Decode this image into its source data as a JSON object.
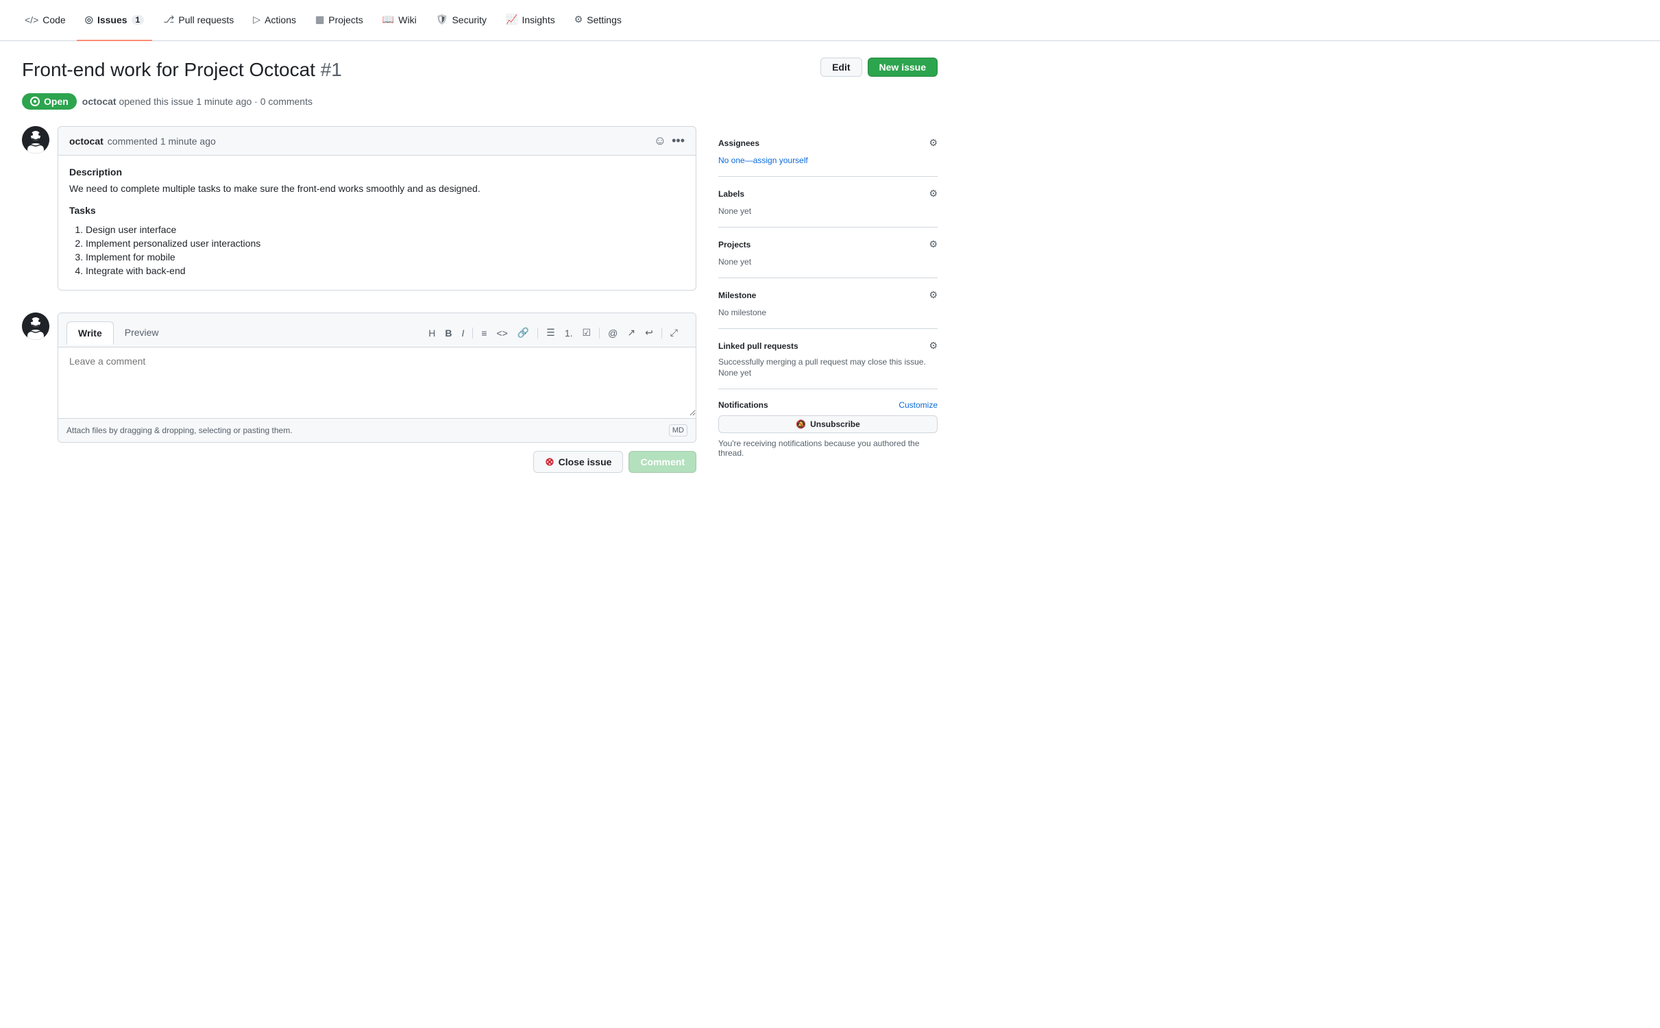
{
  "nav": {
    "items": [
      {
        "id": "code",
        "icon": "<>",
        "label": "Code",
        "badge": null,
        "active": false
      },
      {
        "id": "issues",
        "icon": "◎",
        "label": "Issues",
        "badge": "1",
        "active": true
      },
      {
        "id": "pull-requests",
        "icon": "⎇",
        "label": "Pull requests",
        "badge": null,
        "active": false
      },
      {
        "id": "actions",
        "icon": "▷",
        "label": "Actions",
        "badge": null,
        "active": false
      },
      {
        "id": "projects",
        "icon": "▦",
        "label": "Projects",
        "badge": null,
        "active": false
      },
      {
        "id": "wiki",
        "icon": "📖",
        "label": "Wiki",
        "badge": null,
        "active": false
      },
      {
        "id": "security",
        "icon": "🛡",
        "label": "Security",
        "badge": null,
        "active": false
      },
      {
        "id": "insights",
        "icon": "📈",
        "label": "Insights",
        "badge": null,
        "active": false
      },
      {
        "id": "settings",
        "icon": "⚙",
        "label": "Settings",
        "badge": null,
        "active": false
      }
    ]
  },
  "issue": {
    "title": "Front-end work for Project Octocat",
    "number": "#1",
    "status": "Open",
    "author": "octocat",
    "opened_time": "opened this issue 1 minute ago",
    "comment_count": "0 comments"
  },
  "buttons": {
    "edit": "Edit",
    "new_issue": "New issue"
  },
  "comment": {
    "author": "octocat",
    "action": "commented",
    "time": "1 minute ago",
    "description_heading": "Description",
    "description_text": "We need to complete multiple tasks to make sure the front-end works smoothly and as designed.",
    "tasks_heading": "Tasks",
    "tasks": [
      "Design user interface",
      "Implement personalized user interactions",
      "Implement for mobile",
      "Integrate with back-end"
    ]
  },
  "reply": {
    "write_tab": "Write",
    "preview_tab": "Preview",
    "placeholder": "Leave a comment",
    "attach_text": "Attach files by dragging & dropping, selecting or pasting them.",
    "close_issue_label": "Close issue",
    "comment_label": "Comment"
  },
  "sidebar": {
    "assignees": {
      "title": "Assignees",
      "value": "No one—assign yourself"
    },
    "labels": {
      "title": "Labels",
      "value": "None yet"
    },
    "projects": {
      "title": "Projects",
      "value": "None yet"
    },
    "milestone": {
      "title": "Milestone",
      "value": "No milestone"
    },
    "linked_pr": {
      "title": "Linked pull requests",
      "description": "Successfully merging a pull request may close this issue.",
      "value": "None yet"
    },
    "notifications": {
      "title": "Notifications",
      "customize": "Customize",
      "unsubscribe": "Unsubscribe",
      "note": "You're receiving notifications because you authored the thread."
    }
  }
}
